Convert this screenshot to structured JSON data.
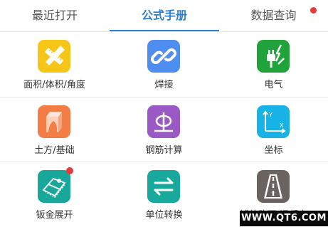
{
  "tabs": [
    {
      "label": "最近打开",
      "active": false,
      "badge": false
    },
    {
      "label": "公式手册",
      "active": true,
      "badge": false
    },
    {
      "label": "数据查询",
      "active": false,
      "badge": true
    }
  ],
  "grid": [
    {
      "label": "面积/体积/角度",
      "icon": "ruler-pencil-icon",
      "color": "#f5c518",
      "badge": false
    },
    {
      "label": "焊接",
      "icon": "chain-link-icon",
      "color": "#4d8ef0",
      "badge": false
    },
    {
      "label": "电气",
      "icon": "electric-plug-icon",
      "color": "#1fa33a",
      "badge": false
    },
    {
      "label": "土方/基础",
      "icon": "earth-block-icon",
      "color": "#f47c45",
      "badge": false
    },
    {
      "label": "钢筋计算",
      "icon": "rebar-section-icon",
      "color": "#9b59c6",
      "badge": false
    },
    {
      "label": "坐标",
      "icon": "coordinate-axes-icon",
      "color": "#18b3e6",
      "badge": false
    },
    {
      "label": "钣金展开",
      "icon": "sheet-metal-icon",
      "color": "#17a899",
      "badge": true
    },
    {
      "label": "单位转换",
      "icon": "swap-arrows-icon",
      "color": "#19a99c",
      "badge": false
    },
    {
      "label": "铺装路面/混凝土",
      "icon": "road-icon",
      "color": "#6b6360",
      "badge": false
    }
  ],
  "watermark": "WWW.QT6.COM"
}
